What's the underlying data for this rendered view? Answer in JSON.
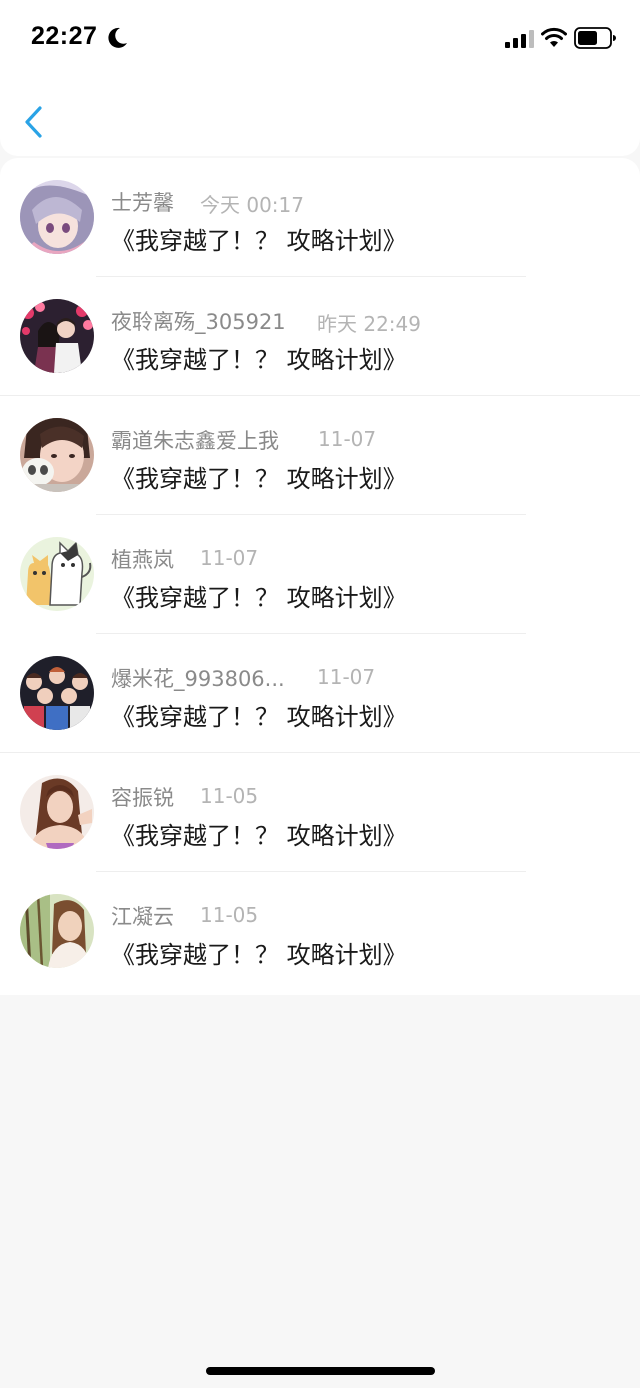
{
  "status_bar": {
    "time": "22:27",
    "icons": [
      "moon-icon",
      "signal-icon",
      "wifi-icon",
      "battery-icon"
    ]
  },
  "nav": {
    "back_icon": "chevron-left-icon",
    "accent_color": "#2aa3e6"
  },
  "comments": [
    {
      "name": "士芳馨",
      "time": "今天 00:17",
      "content": "《我穿越了！？ 攻略计划》",
      "avatar_icon": "anime-girl-avatar"
    },
    {
      "name": "夜聆离殇_305921",
      "time": "昨天 22:49",
      "content": "《我穿越了！？ 攻略计划》",
      "avatar_icon": "couple-photo-avatar"
    },
    {
      "name": "霸道朱志鑫爱上我",
      "time": "11-07",
      "content": "《我穿越了！？ 攻略计划》",
      "avatar_icon": "girl-with-mask-avatar"
    },
    {
      "name": "植燕岚",
      "time": "11-07",
      "content": "《我穿越了！？ 攻略计划》",
      "avatar_icon": "cartoon-cats-avatar"
    },
    {
      "name": "爆米花_993806...",
      "time": "11-07",
      "content": "《我穿越了！？ 攻略计划》",
      "avatar_icon": "group-photo-avatar"
    },
    {
      "name": "容振锐",
      "time": "11-05",
      "content": "《我穿越了！？ 攻略计划》",
      "avatar_icon": "woman-portrait-avatar"
    },
    {
      "name": "江凝云",
      "time": "11-05",
      "content": "《我穿越了！？ 攻略计划》",
      "avatar_icon": "outdoor-portrait-avatar"
    }
  ]
}
